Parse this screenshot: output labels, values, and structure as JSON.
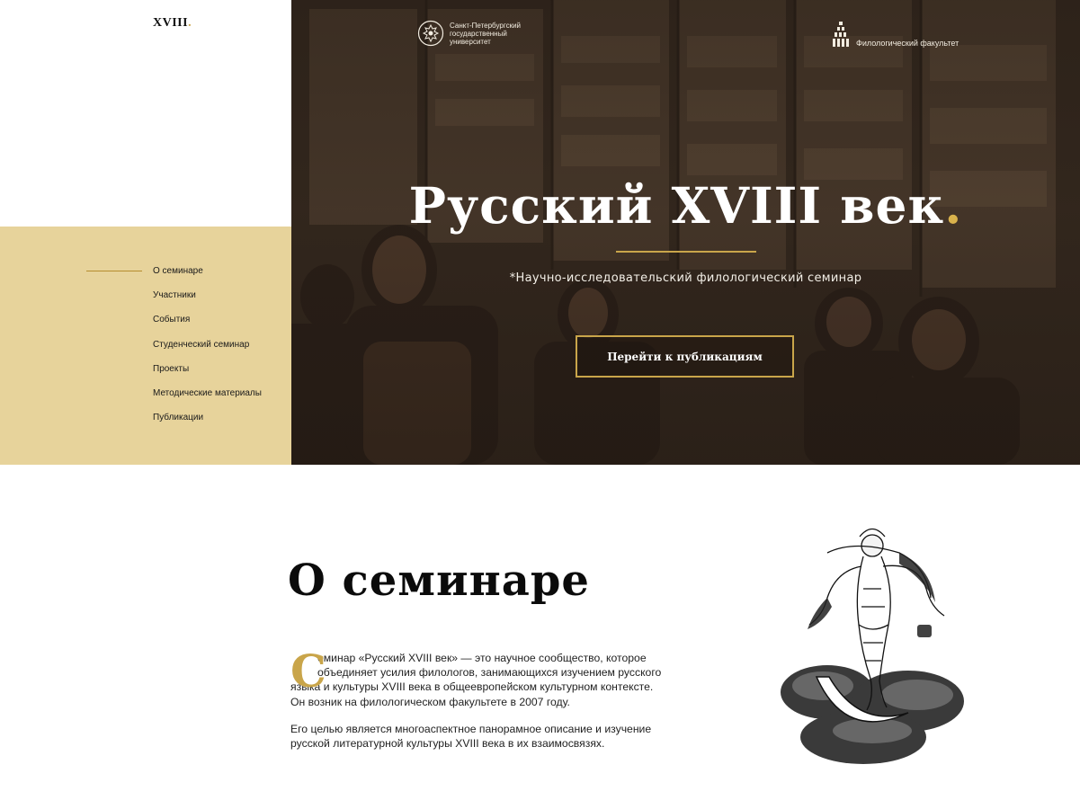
{
  "brand": {
    "logo_text": "XVIII",
    "logo_dot": "."
  },
  "sidebar": {
    "items": [
      {
        "label": "О семинаре",
        "active": true
      },
      {
        "label": "Участники"
      },
      {
        "label": "События"
      },
      {
        "label": "Студенческий семинар"
      },
      {
        "label": "Проекты"
      },
      {
        "label": "Методические материалы"
      },
      {
        "label": "Публикации"
      }
    ]
  },
  "hero": {
    "university": {
      "line1": "Санкт-Петербургский",
      "line2": "государственный",
      "line3": "университет"
    },
    "faculty": "Филологический факультет",
    "title": "Русский XVIII век",
    "title_dot": ".",
    "subtitle": "*Научно-исследовательский филологический семинар",
    "button_label": "Перейти к публикациям"
  },
  "about": {
    "heading": "О семинаре",
    "dropcap": "С",
    "p1_lines": [
      "еминар «Русский XVIII век» — это научное сообщество, которое",
      "объединяет усилия филологов, занимающихся изучением русского",
      "языка и культуры XVIII века в общеевропейском культурном контексте.",
      "Он возник на филологическом факультете в 2007 году."
    ],
    "p2_lines": [
      "Его целью является многоаспектное панорамное описание и изучение",
      "русской литературной культуры XVIII века в их взаимосвязях."
    ]
  },
  "colors": {
    "accent": "#c9a54a",
    "sidebar_bg": "#e7d39b",
    "hero_dark": "#2f241c"
  },
  "icons": {
    "university": "spbu-crest-icon",
    "faculty": "faculty-logo-icon"
  }
}
